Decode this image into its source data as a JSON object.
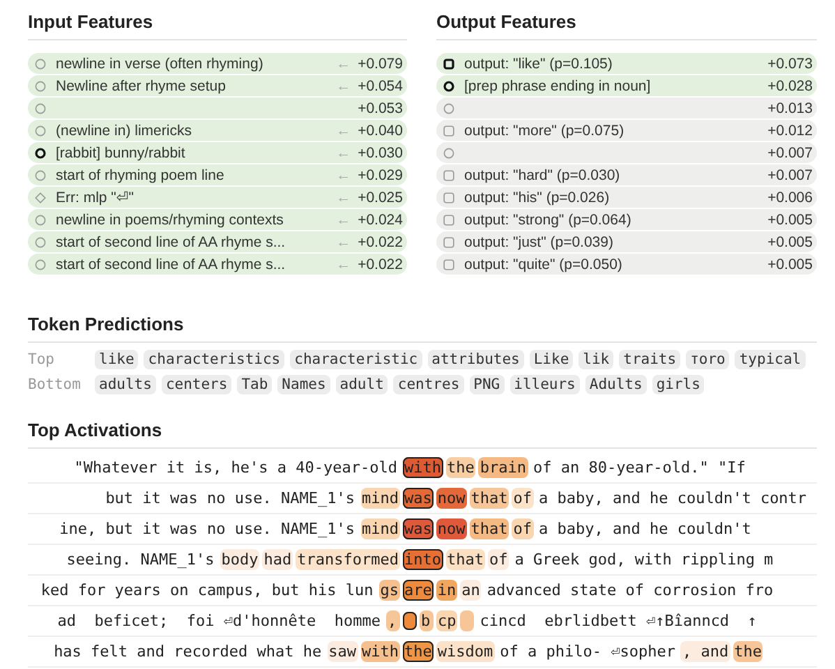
{
  "input_features": {
    "title": "Input Features",
    "rows": [
      {
        "kind": "circle",
        "label": "newline in verse (often rhyming)",
        "arrow": "←",
        "value": "+0.079",
        "highlighted": true
      },
      {
        "kind": "circle",
        "label": "Newline after rhyme setup",
        "arrow": "←",
        "value": "+0.054",
        "highlighted": true
      },
      {
        "kind": "circle",
        "value": "+0.053",
        "highlighted": true
      },
      {
        "kind": "circle",
        "label": "(newline in) limericks",
        "arrow": "←",
        "value": "+0.040",
        "highlighted": true
      },
      {
        "kind": "bold-circle",
        "label": "[rabbit] bunny/rabbit",
        "arrow": "←",
        "value": "+0.030",
        "highlighted": true
      },
      {
        "kind": "circle",
        "label": "start of rhyming poem line",
        "arrow": "←",
        "value": "+0.029",
        "highlighted": true
      },
      {
        "kind": "diamond",
        "label": "Err: mlp \"⏎\"",
        "arrow": "←",
        "value": "+0.025",
        "highlighted": true
      },
      {
        "kind": "circle",
        "label": "newline in poems/rhyming contexts",
        "arrow": "←",
        "value": "+0.024",
        "highlighted": true
      },
      {
        "kind": "circle",
        "label": "start of second line of AA rhyme s...",
        "arrow": "←",
        "value": "+0.022",
        "highlighted": true
      },
      {
        "kind": "circle",
        "label": "start of second line of AA rhyme s...",
        "arrow": "←",
        "value": "+0.022",
        "highlighted": true
      }
    ]
  },
  "output_features": {
    "title": "Output Features",
    "rows": [
      {
        "kind": "bold-square",
        "label": "output: \"like\" (p=0.105)",
        "value": "+0.073",
        "highlighted": true
      },
      {
        "kind": "bold-circle",
        "label": "[prep phrase ending in noun]",
        "value": "+0.028",
        "highlighted": true
      },
      {
        "kind": "circle",
        "value": "+0.013",
        "highlighted": false
      },
      {
        "kind": "square",
        "label": "output: \"more\" (p=0.075)",
        "value": "+0.012",
        "highlighted": false
      },
      {
        "kind": "circle",
        "value": "+0.007",
        "highlighted": false
      },
      {
        "kind": "square",
        "label": "output: \"hard\" (p=0.030)",
        "value": "+0.007",
        "highlighted": false
      },
      {
        "kind": "square",
        "label": "output: \"his\" (p=0.026)",
        "value": "+0.006",
        "highlighted": false
      },
      {
        "kind": "square",
        "label": "output: \"strong\" (p=0.064)",
        "value": "+0.005",
        "highlighted": false
      },
      {
        "kind": "square",
        "label": "output: \"just\" (p=0.039)",
        "value": "+0.005",
        "highlighted": false
      },
      {
        "kind": "square",
        "label": "output: \"quite\" (p=0.050)",
        "value": "+0.005",
        "highlighted": false
      }
    ]
  },
  "token_predictions": {
    "title": "Token Predictions",
    "rows": [
      {
        "label": "Top",
        "tokens": [
          "like",
          "characteristics",
          "characteristic",
          "attributes",
          "Like",
          "lik",
          "traits",
          "тоrо",
          "typical"
        ]
      },
      {
        "label": "Bottom",
        "tokens": [
          "adults",
          "centers",
          "Tab",
          "Names",
          "adult",
          "centres",
          "PNG",
          "illeurs",
          "Adults",
          "girls"
        ]
      }
    ]
  },
  "top_activations": {
    "title": "Top Activations",
    "rows": [
      {
        "before": [
          {
            "text": "\"Whatever it is, he's a 40-year-old"
          }
        ],
        "selected": {
          "text": "with",
          "color": "#de5a32"
        },
        "after": [
          {
            "text": "the",
            "color": "#f8cfa4"
          },
          {
            "text": "brain",
            "color": "#f5b984"
          },
          {
            "text": "of an 80-year-old.\" \"If"
          }
        ]
      },
      {
        "before": [
          {
            "text": "but it was no use. NAME_1's"
          },
          {
            "text": "mind",
            "color": "#f9d6b0"
          }
        ],
        "selected": {
          "text": "was",
          "color": "#e36a36"
        },
        "after": [
          {
            "text": "now",
            "color": "#e3683a"
          },
          {
            "text": "that",
            "color": "#f7c698"
          },
          {
            "text": "of",
            "color": "#fbe2c8"
          },
          {
            "text": "a baby, and he couldn't contr"
          }
        ]
      },
      {
        "before": [
          {
            "text": "ine, but it was no use. NAME_1's"
          },
          {
            "text": "mind",
            "color": "#f9d6b0"
          }
        ],
        "selected": {
          "text": "was",
          "color": "#e0593a"
        },
        "after": [
          {
            "text": "now",
            "color": "#e0593a"
          },
          {
            "text": "that",
            "color": "#f5b984"
          },
          {
            "text": "of",
            "color": "#f9d6b0"
          },
          {
            "text": "a baby, and he couldn't"
          }
        ]
      },
      {
        "before": [
          {
            "text": "seeing. NAME_1's"
          },
          {
            "text": "body",
            "color": "#fcece0"
          },
          {
            "text": "had",
            "color": "#fcece0"
          },
          {
            "text": "transformed",
            "color": "#fbe2c8"
          }
        ],
        "selected": {
          "text": "into",
          "color": "#e86f34"
        },
        "after": [
          {
            "text": "that",
            "color": "#fbdfc2"
          },
          {
            "text": "of",
            "color": "#fcece0"
          },
          {
            "text": "a Greek god, with rippling m"
          }
        ]
      },
      {
        "before": [
          {
            "text": "ked for years on campus, but his lun"
          },
          {
            "text": "gs",
            "color": "#f5c08e"
          }
        ],
        "selected": {
          "text": "are",
          "color": "#ed8a3e"
        },
        "after": [
          {
            "text": "in",
            "color": "#f2a760"
          },
          {
            "text": "an",
            "color": "#fcece0"
          },
          {
            "text": "advanced state of corrosion fro"
          }
        ]
      },
      {
        "before": [
          {
            "text": "ad  beficet;  foi ⏎d'honnête  homme"
          },
          {
            "text": ",",
            "color": "#f7c698"
          }
        ],
        "selected": {
          "color": "#ee8a3c"
        },
        "after": [
          {
            "text": "b",
            "color": "#f7c698"
          },
          {
            "text": "cp",
            "color": "#f9d6b0"
          },
          {
            "color": "#f7c698"
          },
          {
            "text": "cincd  ebrlidbett ⏎↑Bîanncd  ↑"
          }
        ]
      },
      {
        "before": [
          {
            "text": "has felt and recorded what he"
          },
          {
            "text": "saw",
            "color": "#fcece0"
          },
          {
            "text": "with",
            "color": "#f5c08e"
          }
        ],
        "selected": {
          "text": "the",
          "color": "#ef9646"
        },
        "after": [
          {
            "text": "wisdom",
            "color": "#fbe2c8"
          },
          {
            "text": "of a philo- ⏎sopher"
          },
          {
            "text": ", and",
            "color": "#fcece0"
          },
          {
            "text": "the",
            "color": "#f7c698"
          }
        ]
      }
    ]
  }
}
